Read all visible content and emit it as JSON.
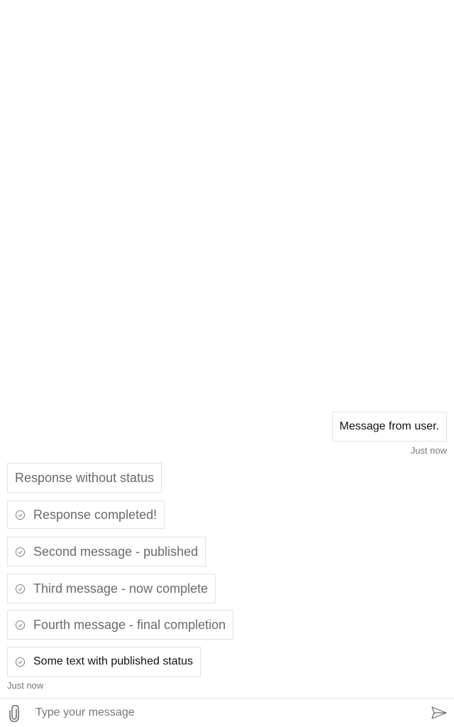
{
  "messages": {
    "user": {
      "text": "Message from user.",
      "timestamp": "Just now"
    },
    "bot": [
      {
        "text": "Response without status",
        "status_icon": null
      },
      {
        "text": "Response completed!",
        "status_icon": "check-circle-icon"
      },
      {
        "text": "Second message - published",
        "status_icon": "check-circle-icon"
      },
      {
        "text": "Third message - now complete",
        "status_icon": "check-circle-icon"
      },
      {
        "text": "Fourth message - final completion",
        "status_icon": "check-circle-icon"
      },
      {
        "text": "Some text with published status",
        "status_icon": "check-circle-icon"
      }
    ],
    "bot_timestamp": "Just now"
  },
  "composer": {
    "placeholder": "Type your message",
    "attach_icon": "paperclip-icon",
    "send_icon": "send-icon"
  },
  "colors": {
    "border": "#e3e3e3",
    "muted_text": "#6a6a6a",
    "dark_text": "#111111",
    "timestamp": "#777777"
  }
}
